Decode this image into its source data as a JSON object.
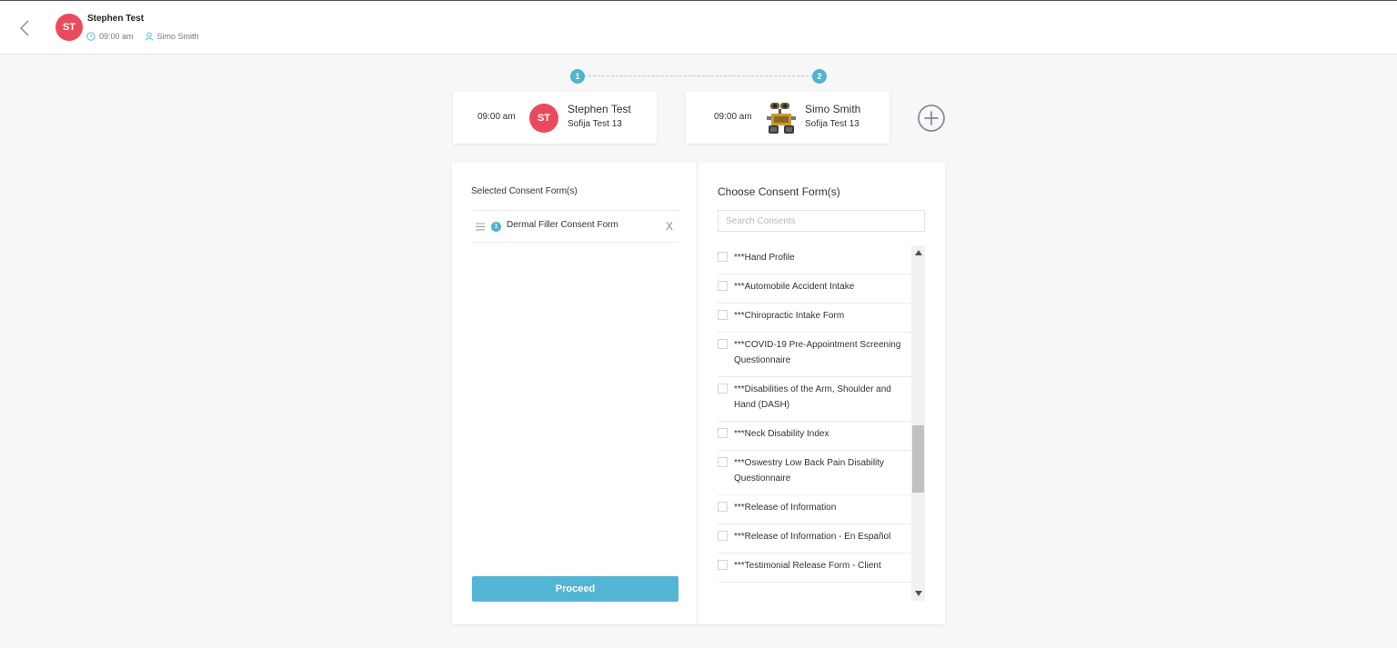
{
  "header": {
    "avatar_initials": "ST",
    "client_name": "Stephen Test",
    "time": "09:00 am",
    "staff_name": "Simo Smith"
  },
  "stepper": {
    "steps": [
      "1",
      "2"
    ]
  },
  "appointments": [
    {
      "time": "09:00 am",
      "avatar_initials": "ST",
      "name": "Stephen Test",
      "sub": "Sofija Test 13"
    },
    {
      "time": "09:00 am",
      "avatar_icon": "robot-avatar",
      "name": "Simo Smith",
      "sub": "Sofija Test 13"
    }
  ],
  "selected_panel": {
    "title": "Selected Consent Form(s)",
    "items": [
      {
        "number": "1",
        "label": "Dermal Filler Consent Form",
        "remove_label": "X"
      }
    ],
    "proceed_label": "Proceed"
  },
  "choose_panel": {
    "title": "Choose Consent Form(s)",
    "search_placeholder": "Search Consents",
    "items": [
      "***Hand Profile",
      "***Automobile Accident Intake",
      "***Chiropractic Intake Form",
      "***COVID-19 Pre-Appointment Screening Questionnaire",
      "***Disabilities of the Arm, Shoulder and Hand (DASH)",
      "***Neck Disability Index",
      "***Oswestry Low Back Pain Disability Questionnaire",
      "***Release of Information",
      "***Release of Information - En Español",
      "***Testimonial Release Form - Client"
    ]
  },
  "colors": {
    "accent": "#54b4d3",
    "avatar_red": "#ea4b5c",
    "background": "#f7f7f8"
  }
}
